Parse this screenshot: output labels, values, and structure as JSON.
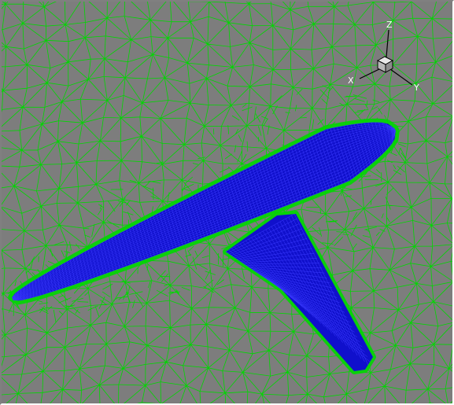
{
  "viewport": {
    "background": "#7d7d7d",
    "volume_mesh_color": "#00d800",
    "surface_mesh_color": "#1010cc",
    "surface_line_color": "#3a3aff"
  },
  "axis_triad": {
    "x_label": "X",
    "y_label": "Y",
    "z_label": "Z"
  }
}
